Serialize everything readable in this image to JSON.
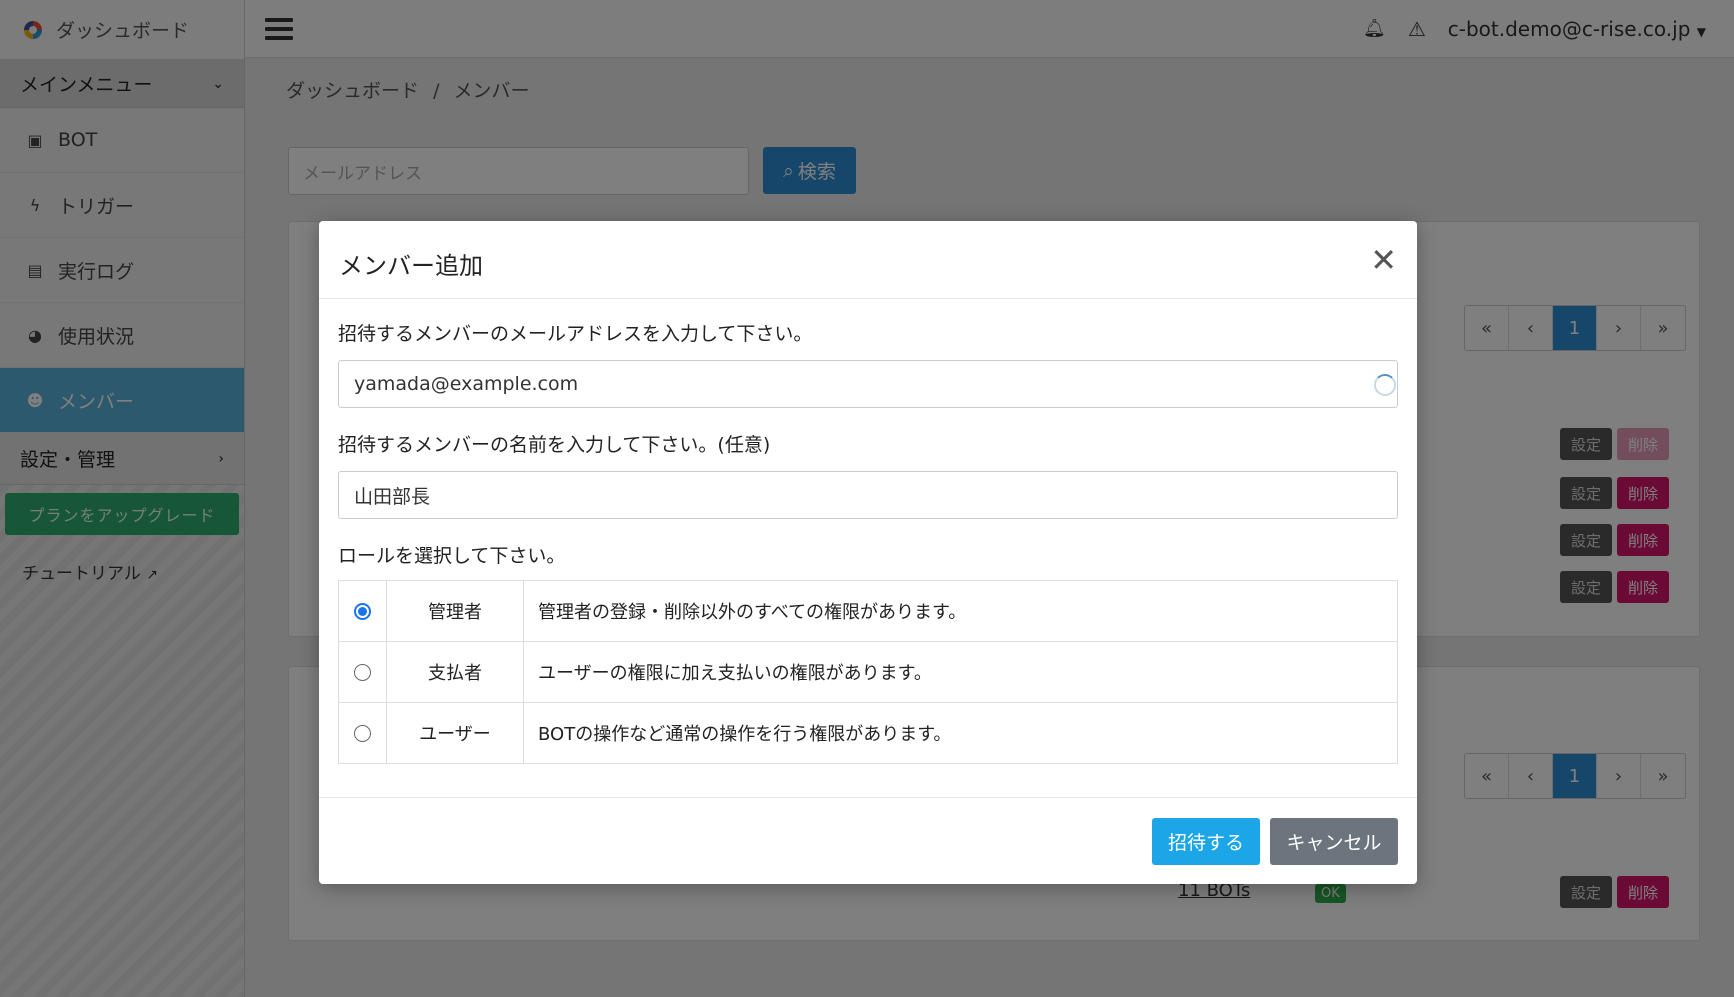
{
  "sidebar": {
    "brand": "ダッシュボード",
    "main_menu": "メインメニュー",
    "items": [
      {
        "label": "BOT",
        "icon": "robot-icon"
      },
      {
        "label": "トリガー",
        "icon": "bolt-icon"
      },
      {
        "label": "実行ログ",
        "icon": "file-icon"
      },
      {
        "label": "使用状況",
        "icon": "pie-chart-icon"
      },
      {
        "label": "メンバー",
        "icon": "users-icon"
      }
    ],
    "settings": "設定・管理",
    "upgrade": "プランをアップグレード",
    "tutorial": "チュートリアル"
  },
  "topbar": {
    "user_email": "c-bot.demo@c-rise.co.jp"
  },
  "breadcrumb": {
    "home": "ダッシュボード",
    "separator": "/",
    "current": "メンバー"
  },
  "search": {
    "placeholder": "メールアドレス",
    "button": "検索"
  },
  "pagination": {
    "current": "1"
  },
  "table": {
    "set_label": "設定",
    "delete_label": "削除",
    "bots_link": "11 BOTs",
    "ok_badge": "OK"
  },
  "modal": {
    "title": "メンバー追加",
    "email_label": "招待するメンバーのメールアドレスを入力して下さい。",
    "email_value": "yamada@example.com",
    "name_label": "招待するメンバーの名前を入力して下さい。(任意)",
    "name_value": "山田部長",
    "role_label": "ロールを選択して下さい。",
    "roles": [
      {
        "name": "管理者",
        "desc": "管理者の登録・削除以外のすべての権限があります。",
        "checked": true
      },
      {
        "name": "支払者",
        "desc": "ユーザーの権限に加え支払いの権限があります。",
        "checked": false
      },
      {
        "name": "ユーザー",
        "desc": "BOTの操作など通常の操作を行う権限があります。",
        "checked": false
      }
    ],
    "invite_button": "招待する",
    "cancel_button": "キャンセル"
  },
  "colors": {
    "primary": "#2c8fd6",
    "active_nav": "#5bb3de",
    "upgrade": "#2eae6e",
    "danger": "#d6176a",
    "invite": "#1ca6e8",
    "secondary": "#6c757d"
  }
}
